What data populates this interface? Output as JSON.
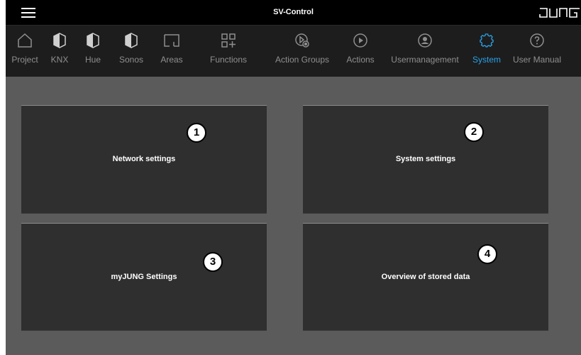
{
  "app": {
    "title": "SV-Control",
    "brand": "JUNG"
  },
  "nav": {
    "items": [
      {
        "label": "Project",
        "icon": "home-icon"
      },
      {
        "label": "KNX",
        "icon": "knx-icon"
      },
      {
        "label": "Hue",
        "icon": "hue-icon"
      },
      {
        "label": "Sonos",
        "icon": "sonos-icon"
      },
      {
        "label": "Areas",
        "icon": "areas-icon"
      },
      {
        "label": "Functions",
        "icon": "functions-icon"
      },
      {
        "label": "Action Groups",
        "icon": "action-groups-icon"
      },
      {
        "label": "Actions",
        "icon": "play-icon"
      },
      {
        "label": "Usermanagement",
        "icon": "user-icon"
      },
      {
        "label": "System",
        "icon": "gear-icon",
        "active": true
      },
      {
        "label": "User Manual",
        "icon": "help-icon"
      }
    ]
  },
  "tiles": [
    {
      "label": "Network settings",
      "callout": "1"
    },
    {
      "label": "System settings",
      "callout": "2"
    },
    {
      "label": "myJUNG Settings",
      "callout": "3"
    },
    {
      "label": "Overview of stored data",
      "callout": "4"
    }
  ],
  "colors": {
    "active": "#2aa1e8",
    "inactive": "#8f8f8f",
    "tile": "#2f2f2f",
    "background": "#5b5b5b"
  }
}
